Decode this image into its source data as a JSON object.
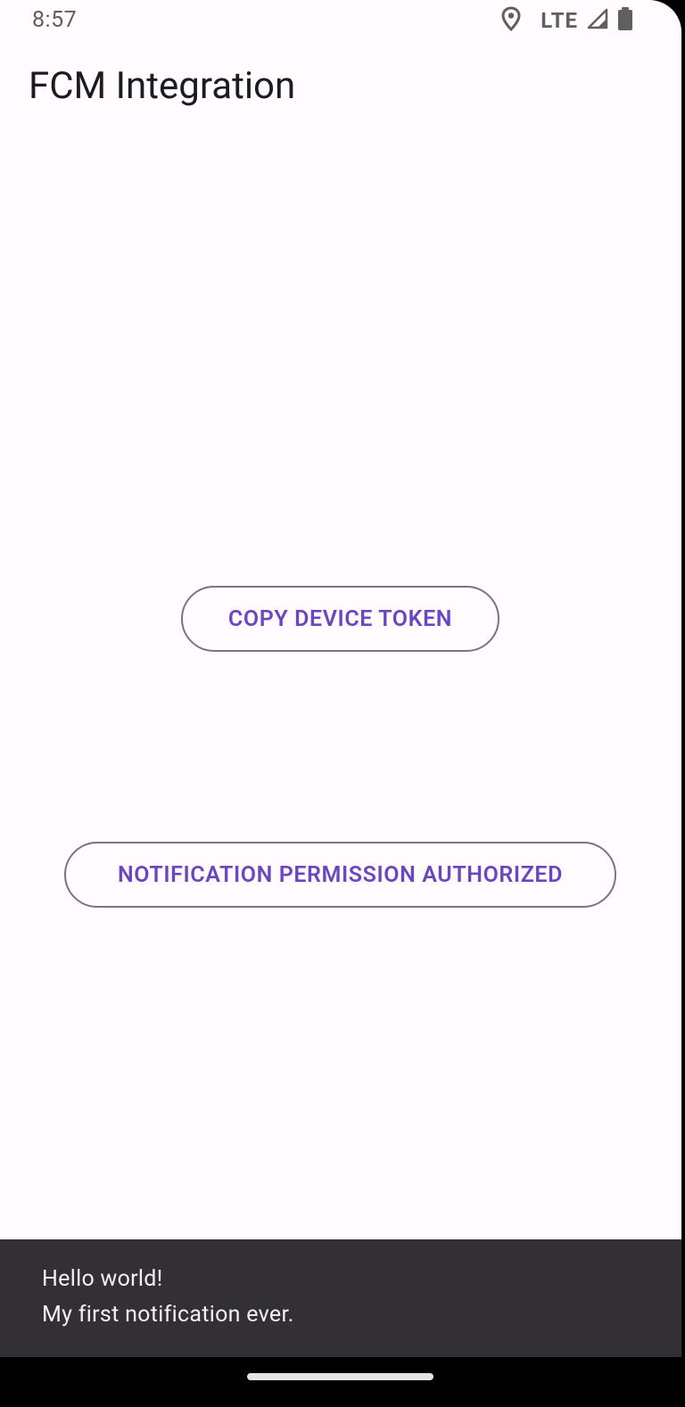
{
  "status_bar": {
    "time": "8:57",
    "network": "LTE",
    "icons": [
      "location-icon",
      "cellular-signal-icon",
      "battery-icon"
    ]
  },
  "app_bar": {
    "title": "FCM Integration"
  },
  "main": {
    "copy_token_label": "COPY DEVICE TOKEN",
    "permission_label": "NOTIFICATION PERMISSION AUTHORIZED"
  },
  "snackbar": {
    "title": "Hello world!",
    "body": "My first notification ever."
  },
  "colors": {
    "background": "#fffbfe",
    "primary": "#6c46c0",
    "outline": "#79747e",
    "snackbar_bg": "#322f35",
    "snackbar_text": "#f4eff4",
    "on_surface": "#1c1b1f"
  }
}
